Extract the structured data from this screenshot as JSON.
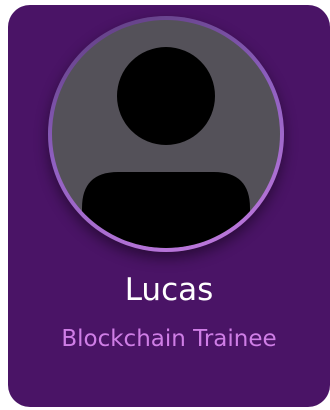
{
  "profile": {
    "name": "Lucas",
    "role": "Blockchain Trainee"
  },
  "colors": {
    "card_background": "#4a1466",
    "avatar_background": "#545159",
    "role_text": "#cf7ee6",
    "name_text": "#ffffff"
  },
  "icons": {
    "avatar": "user-silhouette-icon"
  }
}
